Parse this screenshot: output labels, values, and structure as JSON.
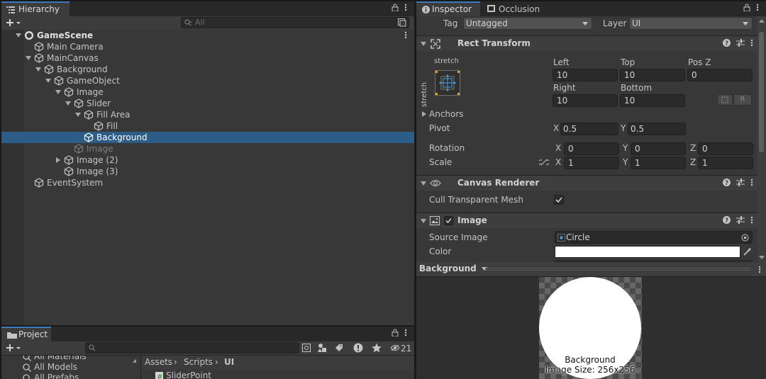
{
  "hierarchy": {
    "tab_label": "Hierarchy",
    "search_placeholder": "All",
    "rows": [
      {
        "label": "GameScene",
        "bold": true
      },
      {
        "label": "Main Camera"
      },
      {
        "label": "MainCanvas"
      },
      {
        "label": "Background"
      },
      {
        "label": "GameObject"
      },
      {
        "label": "Image"
      },
      {
        "label": "Slider"
      },
      {
        "label": "Fill Area"
      },
      {
        "label": "Fill"
      },
      {
        "label": "Background",
        "selected": true
      },
      {
        "label": "Image",
        "inactive": true
      },
      {
        "label": "Image (2)"
      },
      {
        "label": "Image (3)"
      },
      {
        "label": "EventSystem"
      }
    ]
  },
  "project": {
    "tab_label": "Project",
    "hidden_count": "21",
    "favorites": [
      "All Materials",
      "All Models",
      "All Prefabs"
    ],
    "breadcrumb": [
      "Assets",
      "Scripts",
      "UI"
    ],
    "files": [
      "SliderPoint"
    ]
  },
  "inspector": {
    "tabs": [
      "Inspector",
      "Occlusion"
    ],
    "tag_label": "Tag",
    "tag_value": "Untagged",
    "layer_label": "Layer",
    "layer_value": "UI",
    "rect_transform": {
      "title": "Rect Transform",
      "anchor_preset_top": "stretch",
      "anchor_preset_side": "stretch",
      "left_label": "Left",
      "left": "10",
      "top_label": "Top",
      "top": "10",
      "posz_label": "Pos Z",
      "posz": "0",
      "right_label": "Right",
      "right": "10",
      "bottom_label": "Bottom",
      "bottom": "10",
      "raw_button": "R",
      "anchors_label": "Anchors",
      "pivot_label": "Pivot",
      "pivot_x": "0.5",
      "pivot_y": "0.5",
      "rotation_label": "Rotation",
      "rot_x": "0",
      "rot_y": "0",
      "rot_z": "0",
      "scale_label": "Scale",
      "scale_x": "1",
      "scale_y": "1",
      "scale_z": "1",
      "x": "X",
      "y": "Y",
      "z": "Z"
    },
    "canvas_renderer": {
      "title": "Canvas Renderer",
      "cull_label": "Cull Transparent Mesh",
      "cull_checked": true
    },
    "image": {
      "title": "Image",
      "enabled": true,
      "source_label": "Source Image",
      "source_value": "Circle",
      "color_label": "Color",
      "color_value": "#ffffff"
    },
    "preview": {
      "object_name": "Background",
      "caption_name": "Background",
      "caption_size": "Image Size: 256x256"
    }
  },
  "colors": {
    "selection": "#2c5d87",
    "accent": "#3a79bb",
    "panel": "#383838"
  }
}
